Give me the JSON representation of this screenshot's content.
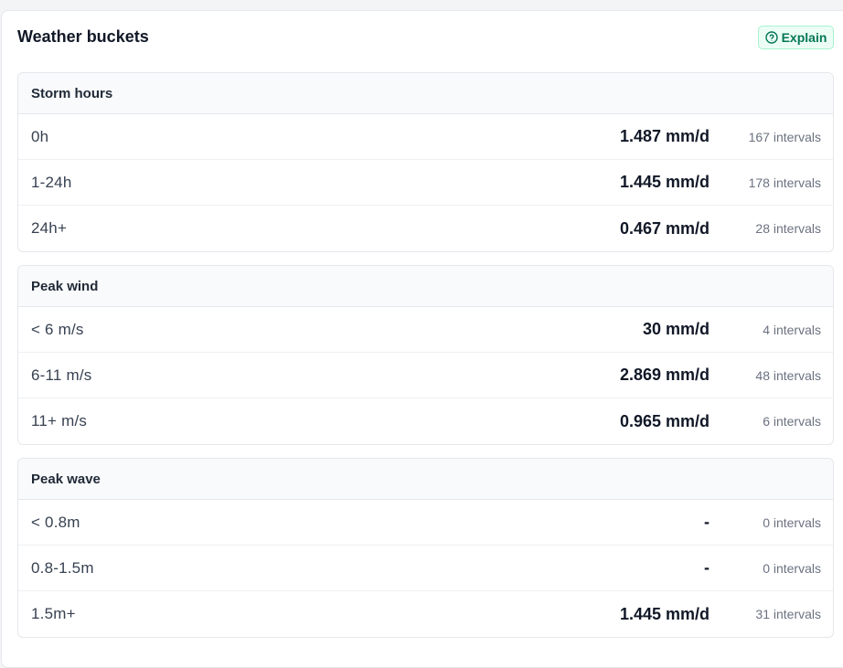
{
  "card": {
    "title": "Weather buckets",
    "explain_label": "Explain",
    "accent_color": "#047857"
  },
  "sections": [
    {
      "title": "Storm hours",
      "rows": [
        {
          "label": "0h",
          "value": "1.487 mm/d",
          "count": "167 intervals"
        },
        {
          "label": "1-24h",
          "value": "1.445 mm/d",
          "count": "178 intervals"
        },
        {
          "label": "24h+",
          "value": "0.467 mm/d",
          "count": "28 intervals"
        }
      ]
    },
    {
      "title": "Peak wind",
      "rows": [
        {
          "label": "< 6 m/s",
          "value": "30 mm/d",
          "count": "4 intervals"
        },
        {
          "label": "6-11 m/s",
          "value": "2.869 mm/d",
          "count": "48 intervals"
        },
        {
          "label": "11+ m/s",
          "value": "0.965 mm/d",
          "count": "6 intervals"
        }
      ]
    },
    {
      "title": "Peak wave",
      "rows": [
        {
          "label": "< 0.8m",
          "value": "-",
          "count": "0 intervals"
        },
        {
          "label": "0.8-1.5m",
          "value": "-",
          "count": "0 intervals"
        },
        {
          "label": "1.5m+",
          "value": "1.445 mm/d",
          "count": "31 intervals"
        }
      ]
    }
  ]
}
